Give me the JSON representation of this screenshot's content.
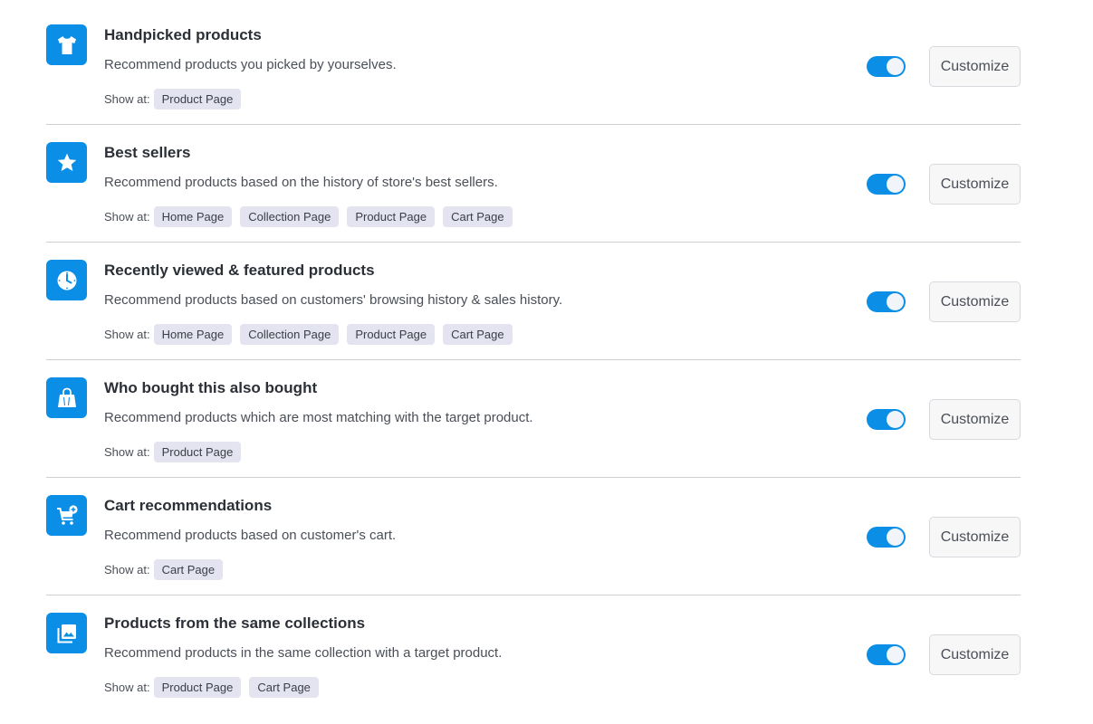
{
  "show_at_label": "Show at:",
  "customize_label": "Customize",
  "accent_color": "#0a8ee6",
  "widgets": [
    {
      "icon": "tshirt-icon",
      "title": "Handpicked products",
      "description": "Recommend products you picked by yourselves.",
      "enabled": true,
      "pages": [
        "Product Page"
      ]
    },
    {
      "icon": "star-icon",
      "title": "Best sellers",
      "description": "Recommend products based on the history of store's best sellers.",
      "enabled": true,
      "pages": [
        "Home Page",
        "Collection Page",
        "Product Page",
        "Cart Page"
      ]
    },
    {
      "icon": "clock-icon",
      "title": "Recently viewed & featured products",
      "description": "Recommend products based on customers' browsing history & sales history.",
      "enabled": true,
      "pages": [
        "Home Page",
        "Collection Page",
        "Product Page",
        "Cart Page"
      ]
    },
    {
      "icon": "shopping-bag-icon",
      "title": "Who bought this also bought",
      "description": "Recommend products which are most matching with the target product.",
      "enabled": true,
      "pages": [
        "Product Page"
      ]
    },
    {
      "icon": "cart-add-icon",
      "title": "Cart recommendations",
      "description": "Recommend products based on customer's cart.",
      "enabled": true,
      "pages": [
        "Cart Page"
      ]
    },
    {
      "icon": "image-collection-icon",
      "title": "Products from the same collections",
      "description": "Recommend products in the same collection with a target product.",
      "enabled": true,
      "pages": [
        "Product Page",
        "Cart Page"
      ]
    }
  ]
}
